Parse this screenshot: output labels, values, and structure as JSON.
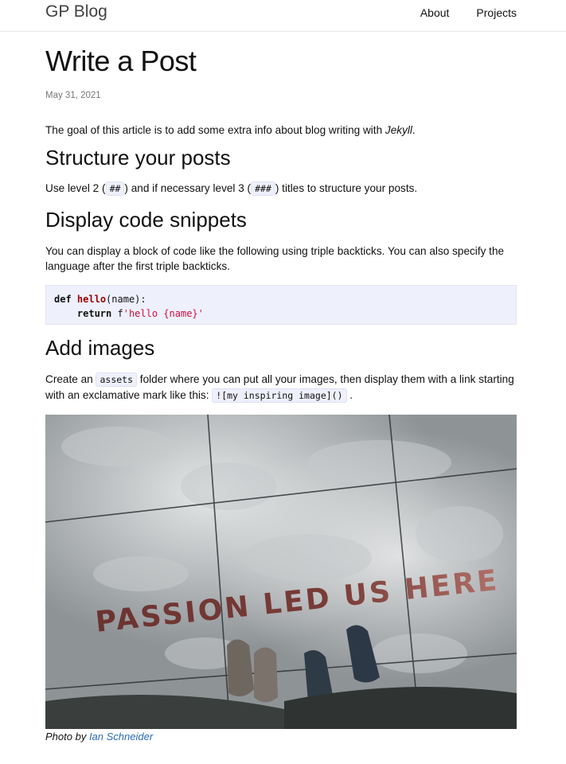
{
  "site": {
    "title": "GP Blog",
    "nav": [
      "About",
      "Projects"
    ]
  },
  "post": {
    "title": "Write a Post",
    "date": "May 31, 2021",
    "intro_text": "The goal of this article is to add some extra info about blog writing with ",
    "intro_em": "Jekyll",
    "intro_end": ".",
    "sections": [
      {
        "heading": "Structure your posts",
        "p1": "Use level 2 (",
        "code1": "##",
        "p2": ") and if necessary level 3 (",
        "code2": "###",
        "p3": ") titles to structure your posts."
      },
      {
        "heading": "Display code snippets",
        "text": "You can display a block of code like the following using triple backticks. You can also specify the language after the first triple backticks.",
        "code": {
          "kw_def": "def",
          "fn_name": "hello",
          "sig": "(name):",
          "kw_return": "return",
          "prefix": "f",
          "str": "'hello {name}'"
        }
      },
      {
        "heading": "Add images",
        "p1": "Create an ",
        "code1": "assets",
        "p2": " folder where you can put all your images, then display them with a link starting with an exclamative mark like this: ",
        "code2": "![my inspiring image]()",
        "p3": " .",
        "image_text": "PASSION LED US HERE",
        "caption_prefix": "Photo by ",
        "caption_link": "Ian Schneider"
      }
    ]
  }
}
